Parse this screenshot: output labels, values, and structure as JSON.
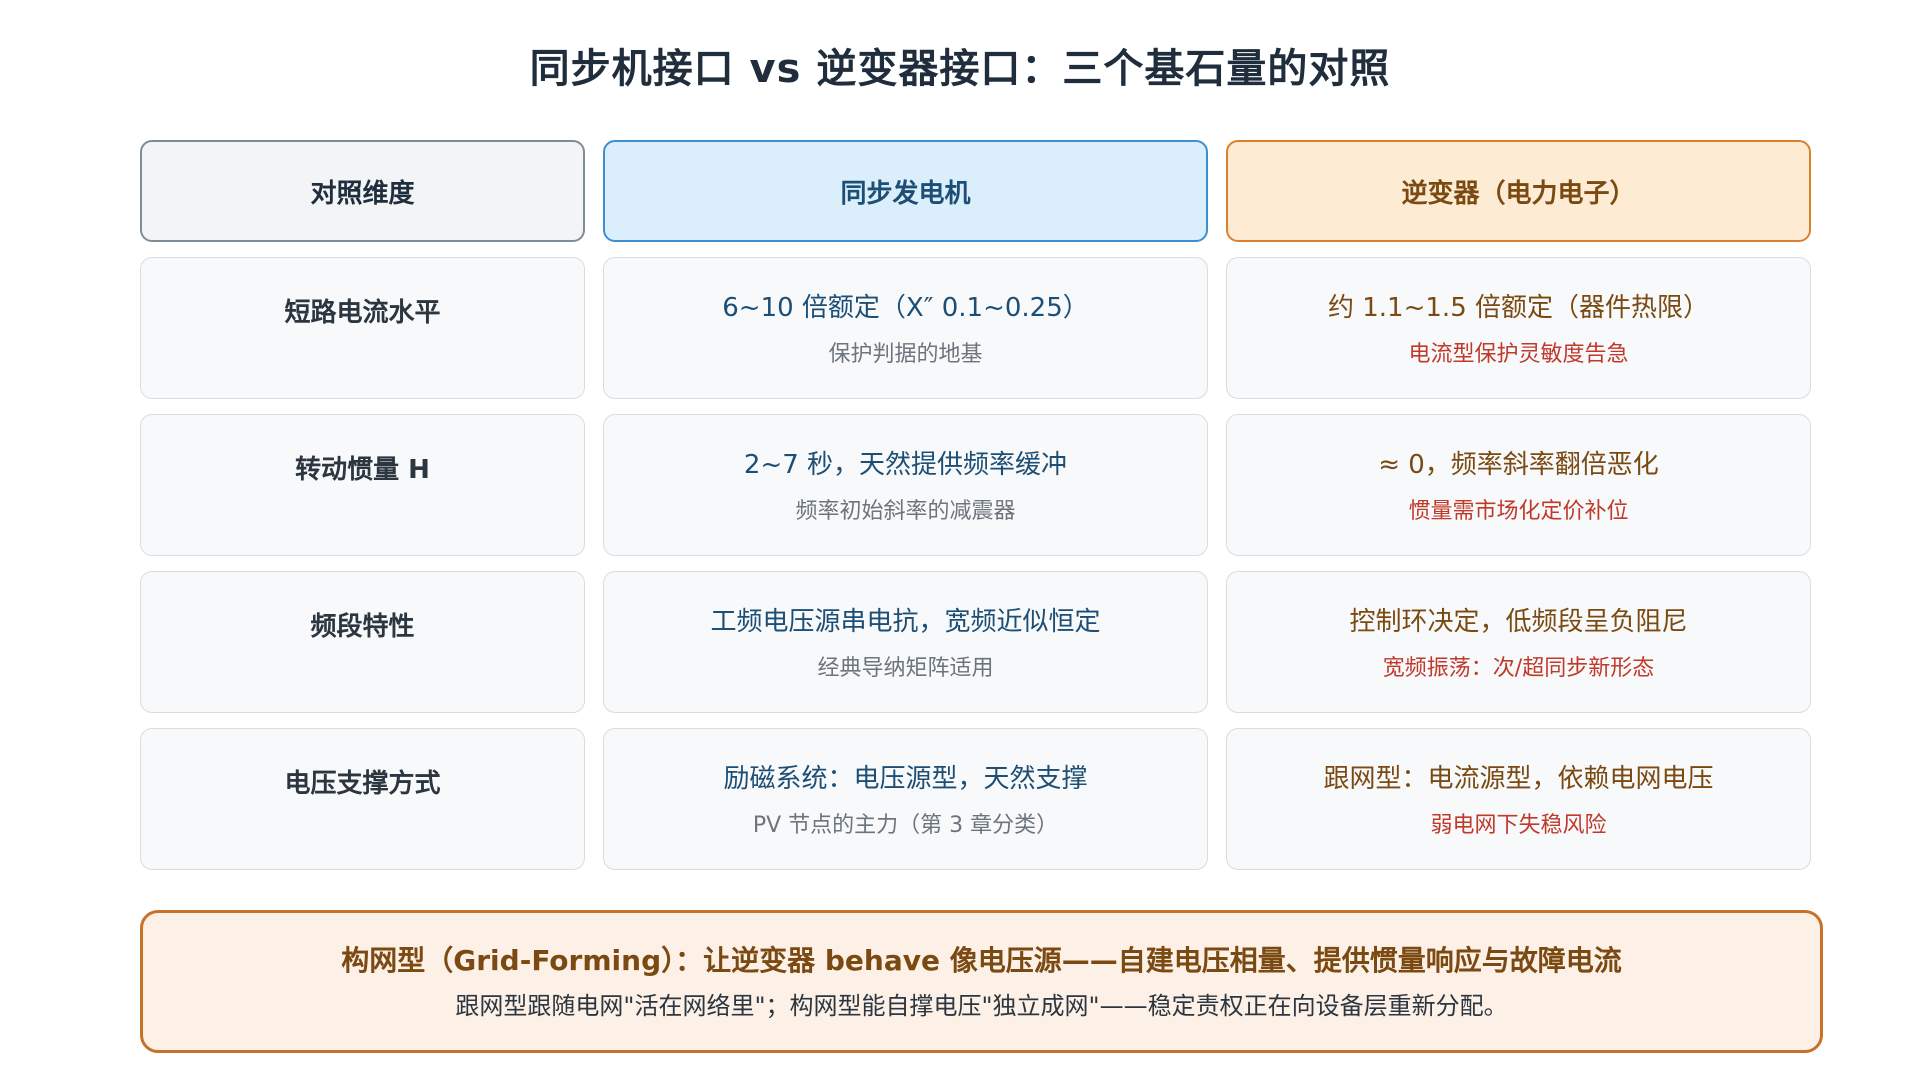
{
  "title": "同步机接口 vs 逆变器接口：三个基石量的对照",
  "headers": {
    "dimension": "对照维度",
    "sync": "同步发电机",
    "inverter": "逆变器（电力电子）"
  },
  "rows": [
    {
      "dimension": "短路电流水平",
      "sync_main": "6~10 倍额定（X″ 0.1~0.25）",
      "sync_sub": "保护判据的地基",
      "inv_main": "约 1.1~1.5 倍额定（器件热限）",
      "inv_sub": "电流型保护灵敏度告急"
    },
    {
      "dimension": "转动惯量 H",
      "sync_main": "2~7 秒，天然提供频率缓冲",
      "sync_sub": "频率初始斜率的减震器",
      "inv_main": "≈ 0，频率斜率翻倍恶化",
      "inv_sub": "惯量需市场化定价补位"
    },
    {
      "dimension": "频段特性",
      "sync_main": "工频电压源串电抗，宽频近似恒定",
      "sync_sub": "经典导纳矩阵适用",
      "inv_main": "控制环决定，低频段呈负阻尼",
      "inv_sub": "宽频振荡：次/超同步新形态"
    },
    {
      "dimension": "电压支撑方式",
      "sync_main": "励磁系统：电压源型，天然支撑",
      "sync_sub": "PV 节点的主力（第 3 章分类）",
      "inv_main": "跟网型：电流源型，依赖电网电压",
      "inv_sub": "弱电网下失稳风险"
    }
  ],
  "callout": {
    "title": "构网型（Grid-Forming）：让逆变器 behave 像电压源——自建电压相量、提供惯量响应与故障电流",
    "text": "跟网型跟随电网\"活在网络里\"；构网型能自撑电压\"独立成网\"——稳定责权正在向设备层重新分配。"
  }
}
